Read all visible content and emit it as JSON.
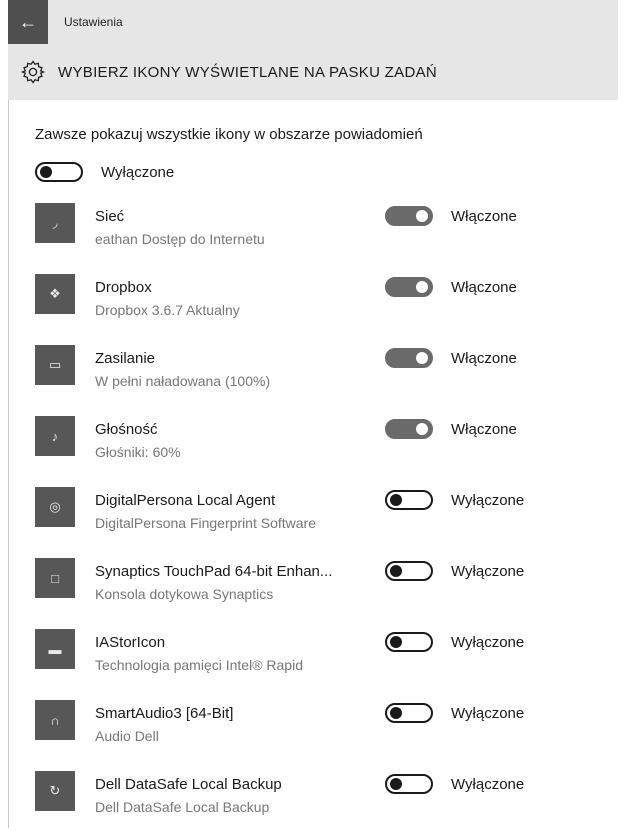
{
  "window": {
    "app_title": "Ustawienia",
    "back_icon": "arrow-left-icon"
  },
  "header": {
    "title": "WYBIERZ IKONY WYŚWIETLANE NA PASKU ZADAŃ",
    "icon": "gear-icon"
  },
  "master": {
    "label": "Zawsze pokazuj wszystkie ikony w obszarze powiadomień",
    "state": false,
    "state_label": "Wyłączone"
  },
  "items": [
    {
      "name": "Sieć",
      "subtitle": "eathan Dostęp do Internetu",
      "icon": "wifi-icon",
      "on": true,
      "state_label": "Włączone"
    },
    {
      "name": "Dropbox",
      "subtitle": "Dropbox 3.6.7 Aktualny",
      "icon": "dropbox-icon",
      "on": true,
      "state_label": "Włączone"
    },
    {
      "name": "Zasilanie",
      "subtitle": "W pełni naładowana (100%)",
      "icon": "battery-icon",
      "on": true,
      "state_label": "Włączone"
    },
    {
      "name": "Głośność",
      "subtitle": "Głośniki: 60%",
      "icon": "speaker-icon",
      "on": true,
      "state_label": "Włączone"
    },
    {
      "name": "DigitalPersona Local Agent",
      "subtitle": "DigitalPersona Fingerprint Software",
      "icon": "fingerprint-icon",
      "on": false,
      "state_label": "Wyłączone"
    },
    {
      "name": "Synaptics TouchPad 64-bit Enhan...",
      "subtitle": "Konsola dotykowa Synaptics",
      "icon": "touchpad-icon",
      "on": false,
      "state_label": "Wyłączone"
    },
    {
      "name": "IAStorIcon",
      "subtitle": "Technologia pamięci Intel® Rapid",
      "icon": "storage-icon",
      "on": false,
      "state_label": "Wyłączone"
    },
    {
      "name": "SmartAudio3 [64-Bit]",
      "subtitle": "Audio Dell",
      "icon": "headphones-icon",
      "on": false,
      "state_label": "Wyłączone"
    },
    {
      "name": "Dell DataSafe Local Backup",
      "subtitle": "Dell DataSafe Local Backup",
      "icon": "backup-icon",
      "on": false,
      "state_label": "Wyłączone"
    }
  ]
}
